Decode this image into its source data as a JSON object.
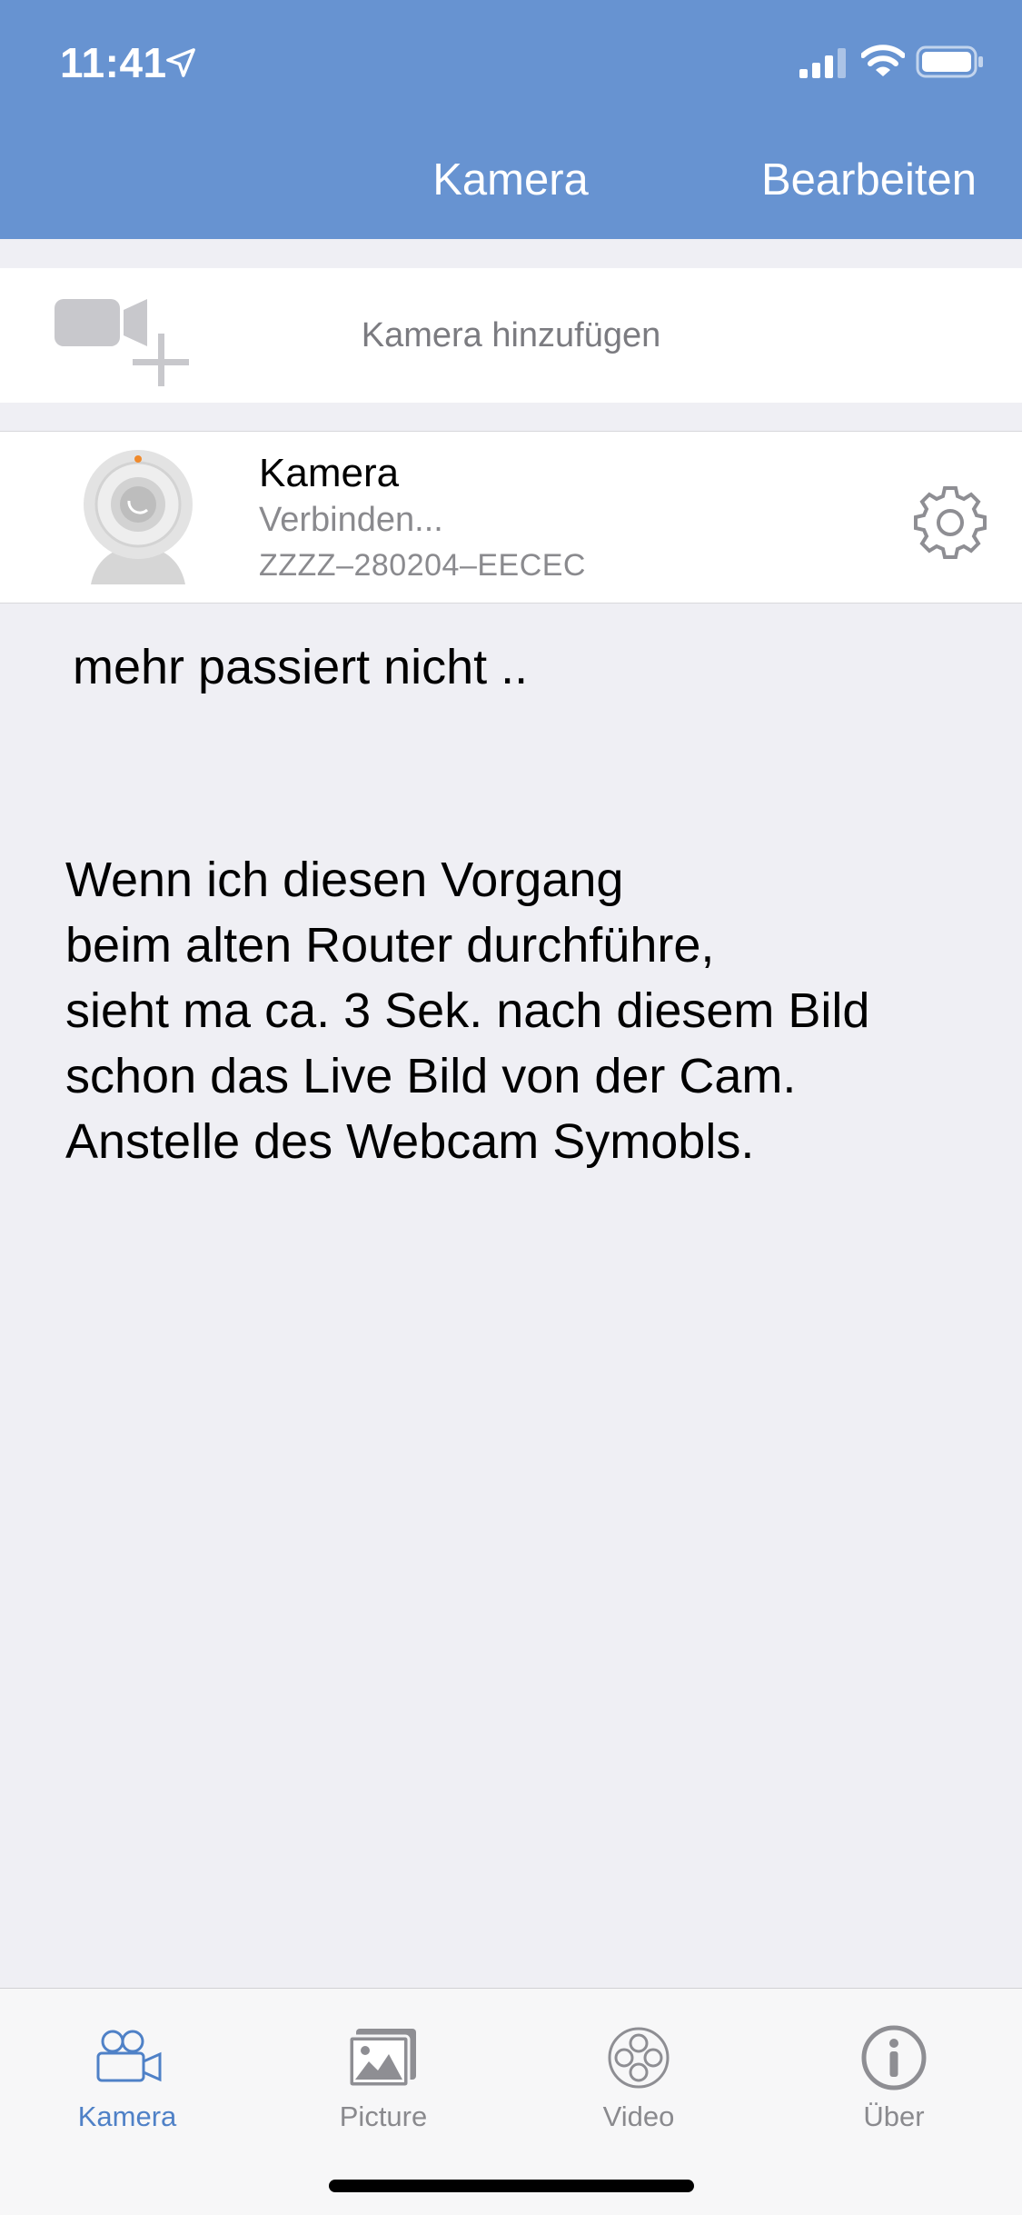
{
  "status_bar": {
    "time": "11:41"
  },
  "nav": {
    "title": "Kamera",
    "edit_label": "Bearbeiten"
  },
  "add_camera": {
    "label": "Kamera hinzufügen",
    "icon": "add-camera-icon"
  },
  "camera": {
    "name": "Kamera",
    "status": "Verbinden...",
    "id": "ZZZZ–280204–EECEC",
    "icon": "webcam-icon",
    "settings_icon": "gear-icon"
  },
  "annotation": {
    "line1": "mehr passiert nicht ..",
    "lines": [
      "Wenn ich diesen Vorgang",
      "beim alten Router durchführe,",
      "sieht ma ca. 3 Sek. nach diesem Bild",
      "schon das Live Bild von der Cam.",
      "Anstelle des Webcam Symobls."
    ]
  },
  "tabs": [
    {
      "label": "Kamera",
      "icon": "video-camera-icon",
      "active": true
    },
    {
      "label": "Picture",
      "icon": "picture-icon",
      "active": false
    },
    {
      "label": "Video",
      "icon": "film-reel-icon",
      "active": false
    },
    {
      "label": "Über",
      "icon": "info-icon",
      "active": false
    }
  ],
  "colors": {
    "header_blue": "#6793d1",
    "active_tab": "#4f81c7",
    "inactive_tab": "#8a8a8e",
    "background": "#efeff4"
  }
}
